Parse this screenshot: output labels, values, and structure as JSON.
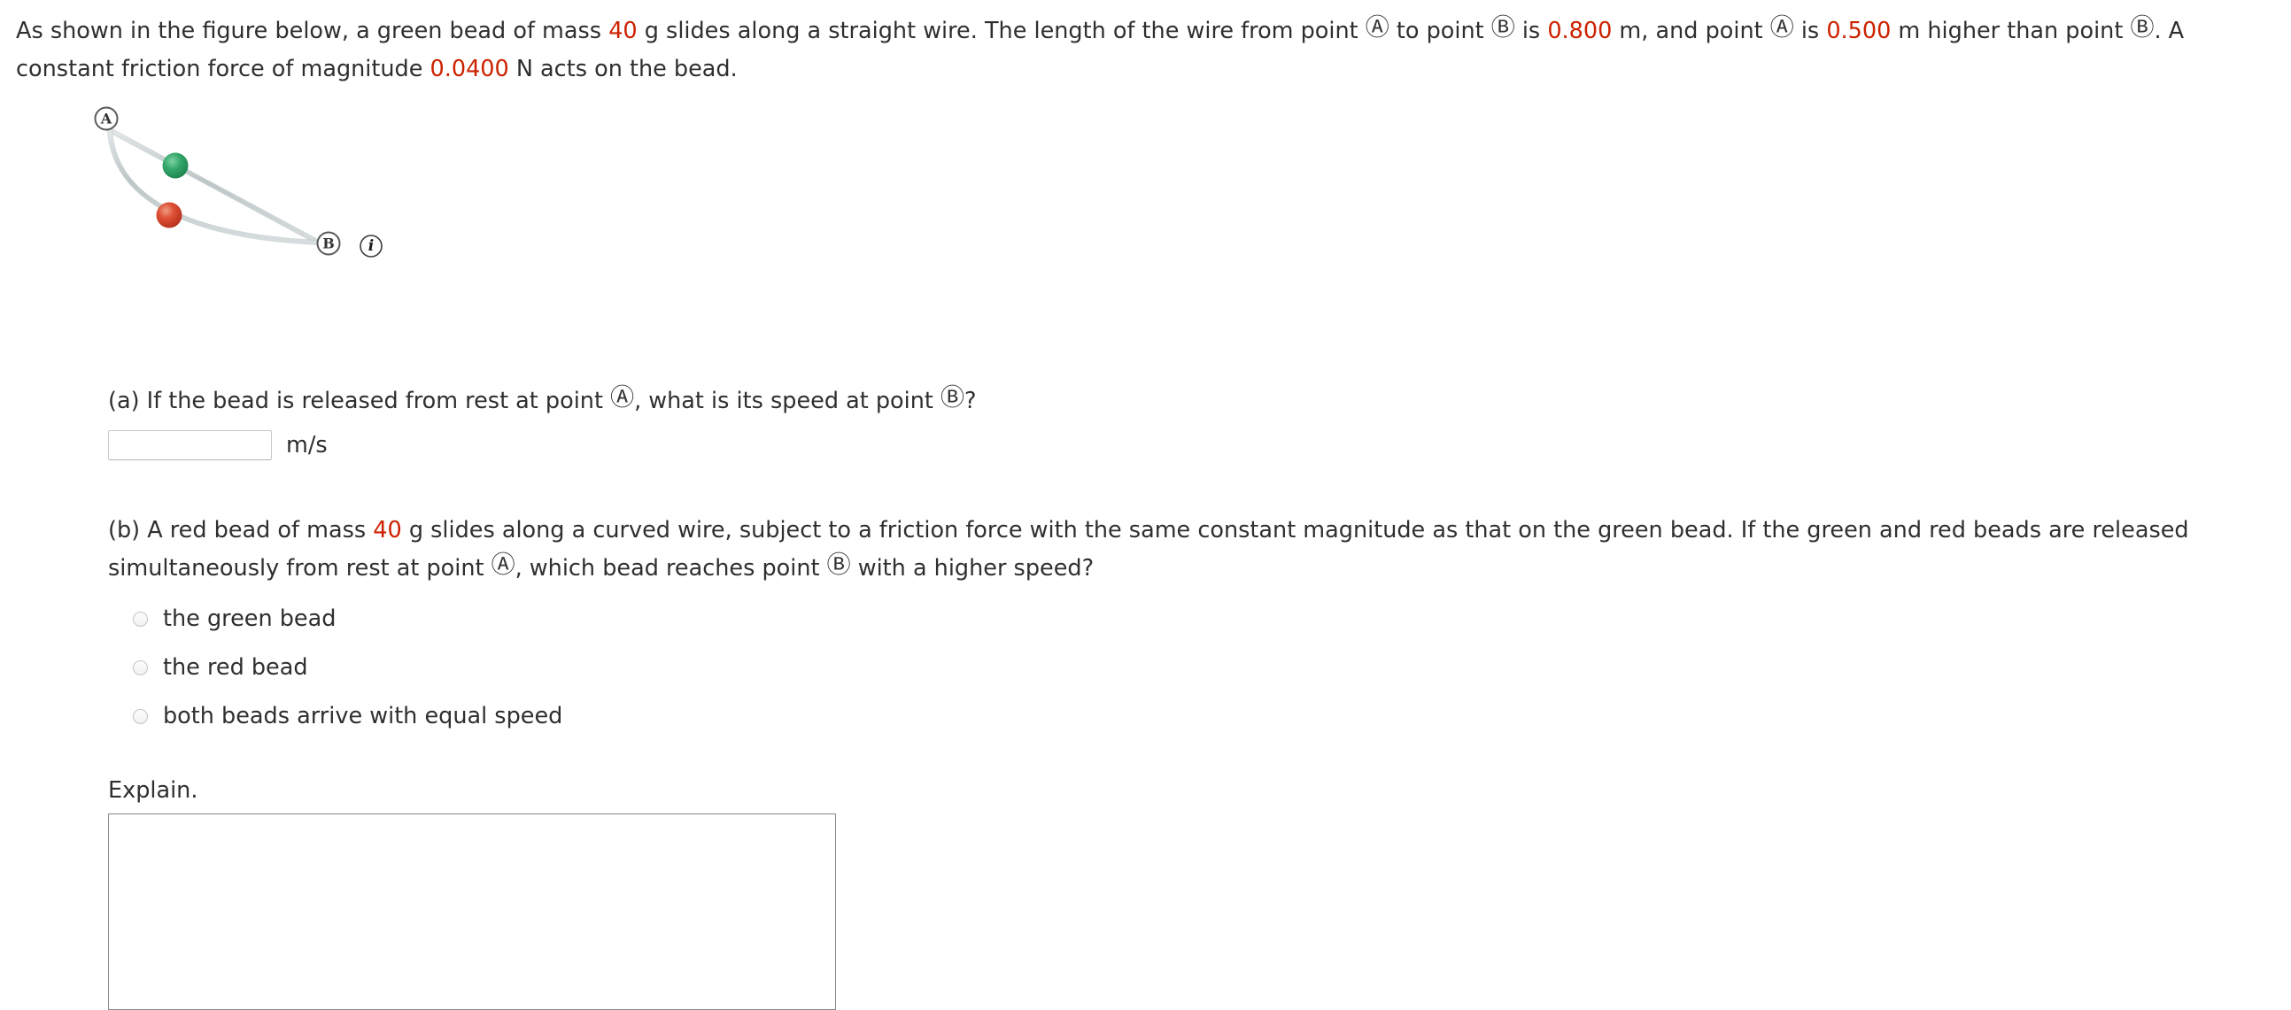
{
  "problem": {
    "intro_part1": "As shown in the figure below, a green bead of mass ",
    "mass_value": "40",
    "intro_part2": " g slides along a straight wire. The length of the wire from point ",
    "label_a": "Ⓐ",
    "intro_part3": " to point ",
    "label_b": "Ⓑ",
    "intro_part4": " is ",
    "length_value": "0.800",
    "intro_part5": " m, and point ",
    "intro_part6": " is ",
    "height_value": "0.500",
    "intro_part7": " m higher than point ",
    "intro_part8": ". A constant friction force of magnitude ",
    "friction_value": "0.0400",
    "intro_part9": " N acts on the bead."
  },
  "figure": {
    "point_a_label": "A",
    "point_b_label": "B",
    "info_icon_label": "i",
    "green_bead_color": "#2f9e63",
    "red_bead_color": "#d8452c",
    "wire_color": "#c3cbcd"
  },
  "part_a": {
    "text_1": "(a) If the bead is released from rest at point ",
    "label_a": "Ⓐ",
    "text_2": ", what is its speed at point ",
    "label_b": "Ⓑ",
    "text_3": "?",
    "input_value": "",
    "input_placeholder": "",
    "unit": "m/s"
  },
  "part_b": {
    "text_1": "(b) A red bead of mass ",
    "mass_value": "40",
    "text_2": " g slides along a curved wire, subject to a friction force with the same constant magnitude as that on the green bead. If the green and red beads are released simultaneously from rest at point ",
    "label_a": "Ⓐ",
    "text_3": ", which bead reaches point ",
    "label_b": "Ⓑ",
    "text_4": " with a higher speed?",
    "choices": [
      {
        "label": "the green bead",
        "selected": false
      },
      {
        "label": "the red bead",
        "selected": false
      },
      {
        "label": "both beads arrive with equal speed",
        "selected": false
      }
    ]
  },
  "explain": {
    "label": "Explain.",
    "value": "",
    "placeholder": ""
  },
  "colors": {
    "highlight": "#cc2200",
    "text": "#2f2f2f"
  }
}
